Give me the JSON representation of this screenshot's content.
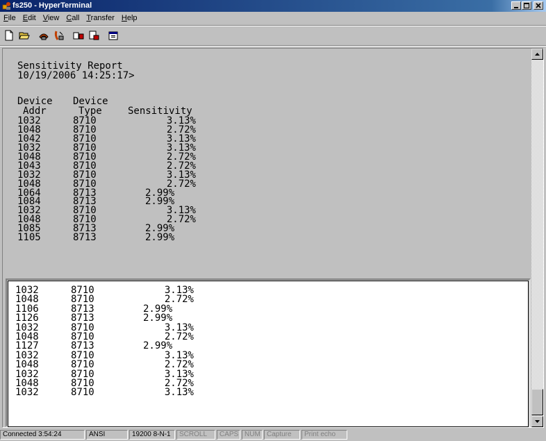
{
  "window": {
    "title": "fs250 - HyperTerminal",
    "title_bar_color": "#0a246a"
  },
  "menu": [
    {
      "label": "File",
      "accel": "F",
      "rest": "ile"
    },
    {
      "label": "Edit",
      "accel": "E",
      "rest": "dit"
    },
    {
      "label": "View",
      "accel": "V",
      "rest": "iew"
    },
    {
      "label": "Call",
      "accel": "C",
      "rest": "all"
    },
    {
      "label": "Transfer",
      "accel": "T",
      "rest": "ransfer"
    },
    {
      "label": "Help",
      "accel": "H",
      "rest": "elp"
    }
  ],
  "toolbar": {
    "icons": [
      "new-icon",
      "open-icon",
      "connect-icon",
      "disconnect-icon",
      "send-icon",
      "receive-icon",
      "properties-icon"
    ]
  },
  "terminal": {
    "report_title": "Sensitivity Report",
    "report_datetime": "10/19/2006 14:25:17>",
    "headers": {
      "addr_line1": "Device",
      "type_line1": "Device",
      "addr_line2": "Addr",
      "type_line2": "Type",
      "sens": "Sensitivity"
    },
    "rows": [
      {
        "addr": "1032",
        "type": "8710",
        "sens": "3.13%"
      },
      {
        "addr": "1048",
        "type": "8710",
        "sens": "2.72%"
      },
      {
        "addr": "1042",
        "type": "8710",
        "sens": "3.13%"
      },
      {
        "addr": "1032",
        "type": "8710",
        "sens": "3.13%"
      },
      {
        "addr": "1048",
        "type": "8710",
        "sens": "2.72%"
      },
      {
        "addr": "1043",
        "type": "8710",
        "sens": "2.72%"
      },
      {
        "addr": "1032",
        "type": "8710",
        "sens": "3.13%"
      },
      {
        "addr": "1048",
        "type": "8710",
        "sens": "2.72%"
      },
      {
        "addr": "1064",
        "type": "8713",
        "sens": "2.99%"
      },
      {
        "addr": "1084",
        "type": "8713",
        "sens": "2.99%"
      },
      {
        "addr": "1032",
        "type": "8710",
        "sens": "3.13%"
      },
      {
        "addr": "1048",
        "type": "8710",
        "sens": "2.72%"
      },
      {
        "addr": "1085",
        "type": "8713",
        "sens": "2.99%"
      },
      {
        "addr": "1105",
        "type": "8713",
        "sens": "2.99%"
      }
    ],
    "lower_rows": [
      {
        "addr": "1032",
        "type": "8710",
        "sens": "3.13%"
      },
      {
        "addr": "1048",
        "type": "8710",
        "sens": "2.72%"
      },
      {
        "addr": "1106",
        "type": "8713",
        "sens": "2.99%"
      },
      {
        "addr": "1126",
        "type": "8713",
        "sens": "2.99%"
      },
      {
        "addr": "1032",
        "type": "8710",
        "sens": "3.13%"
      },
      {
        "addr": "1048",
        "type": "8710",
        "sens": "2.72%"
      },
      {
        "addr": "1127",
        "type": "8713",
        "sens": "2.99%"
      },
      {
        "addr": "1032",
        "type": "8710",
        "sens": "3.13%"
      },
      {
        "addr": "1048",
        "type": "8710",
        "sens": "2.72%"
      },
      {
        "addr": "1032",
        "type": "8710",
        "sens": "3.13%"
      },
      {
        "addr": "1048",
        "type": "8710",
        "sens": "2.72%"
      },
      {
        "addr": "1032",
        "type": "8710",
        "sens": "3.13%"
      }
    ]
  },
  "status": {
    "connected": "Connected 3:54:24",
    "emulation": "ANSI",
    "port": "19200 8-N-1",
    "scroll": "SCROLL",
    "caps": "CAPS",
    "num": "NUM",
    "capture": "Capture",
    "print_echo": "Print echo"
  }
}
